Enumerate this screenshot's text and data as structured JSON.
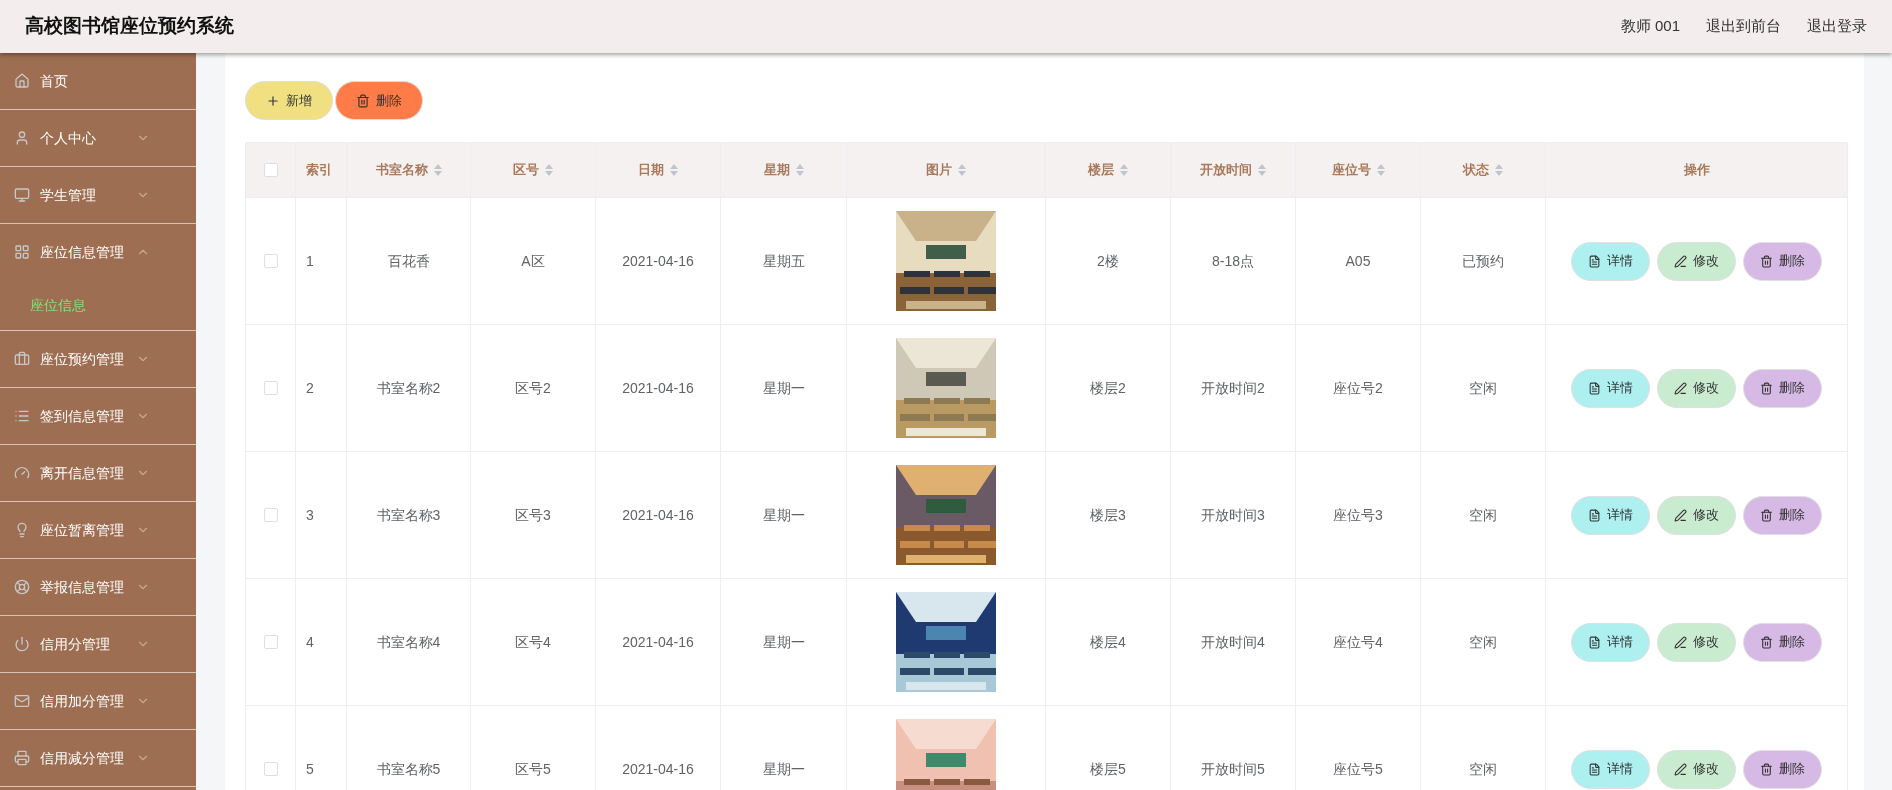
{
  "header": {
    "title": "高校图书馆座位预约系统",
    "user": "教师 001",
    "links": [
      "退出到前台",
      "退出登录"
    ]
  },
  "sidebar": {
    "items": [
      {
        "label": "首页",
        "expandable": false
      },
      {
        "label": "个人中心",
        "expandable": true,
        "expanded": false
      },
      {
        "label": "学生管理",
        "expandable": true,
        "expanded": false
      },
      {
        "label": "座位信息管理",
        "expandable": true,
        "expanded": true,
        "children": [
          {
            "label": "座位信息",
            "selected": true
          }
        ]
      },
      {
        "label": "座位预约管理",
        "expandable": true,
        "expanded": false
      },
      {
        "label": "签到信息管理",
        "expandable": true,
        "expanded": false
      },
      {
        "label": "离开信息管理",
        "expandable": true,
        "expanded": false
      },
      {
        "label": "座位暂离管理",
        "expandable": true,
        "expanded": false
      },
      {
        "label": "举报信息管理",
        "expandable": true,
        "expanded": false
      },
      {
        "label": "信用分管理",
        "expandable": true,
        "expanded": false
      },
      {
        "label": "信用加分管理",
        "expandable": true,
        "expanded": false
      },
      {
        "label": "信用减分管理",
        "expandable": true,
        "expanded": false
      }
    ]
  },
  "toolbar": [
    {
      "kind": "add",
      "label": "新增"
    },
    {
      "kind": "delete",
      "label": "删除"
    }
  ],
  "table": {
    "select_all": {
      "checked": false
    },
    "columns": [
      {
        "label": "索引",
        "sortable": false
      },
      {
        "label": "书室名称",
        "sortable": true
      },
      {
        "label": "区号",
        "sortable": true
      },
      {
        "label": "日期",
        "sortable": true
      },
      {
        "label": "星期",
        "sortable": true
      },
      {
        "label": "图片",
        "sortable": true
      },
      {
        "label": "楼层",
        "sortable": true
      },
      {
        "label": "开放时间",
        "sortable": true
      },
      {
        "label": "座位号",
        "sortable": true
      },
      {
        "label": "状态",
        "sortable": true
      },
      {
        "label": "操作",
        "sortable": false
      }
    ],
    "rows": [
      {
        "checked": false,
        "cells": [
          "1",
          "百花香",
          "A区",
          "2021-04-16",
          "星期五"
        ],
        "image": {
          "kind": "picture"
        },
        "cells2": [
          "2楼",
          "8-18点",
          "A05",
          "已预约"
        ],
        "actions": [
          {
            "kind": "detail",
            "label": "详情"
          },
          {
            "kind": "edit",
            "label": "修改"
          },
          {
            "kind": "delete",
            "label": "删除"
          }
        ]
      },
      {
        "checked": false,
        "cells": [
          "2",
          "书室名称2",
          "区号2",
          "2021-04-16",
          "星期一"
        ],
        "image": {
          "kind": "picture"
        },
        "cells2": [
          "楼层2",
          "开放时间2",
          "座位号2",
          "空闲"
        ],
        "actions": [
          {
            "kind": "detail",
            "label": "详情"
          },
          {
            "kind": "edit",
            "label": "修改"
          },
          {
            "kind": "delete",
            "label": "删除"
          }
        ]
      },
      {
        "checked": false,
        "cells": [
          "3",
          "书室名称3",
          "区号3",
          "2021-04-16",
          "星期一"
        ],
        "image": {
          "kind": "picture"
        },
        "cells2": [
          "楼层3",
          "开放时间3",
          "座位号3",
          "空闲"
        ],
        "actions": [
          {
            "kind": "detail",
            "label": "详情"
          },
          {
            "kind": "edit",
            "label": "修改"
          },
          {
            "kind": "delete",
            "label": "删除"
          }
        ]
      },
      {
        "checked": false,
        "cells": [
          "4",
          "书室名称4",
          "区号4",
          "2021-04-16",
          "星期一"
        ],
        "image": {
          "kind": "picture"
        },
        "cells2": [
          "楼层4",
          "开放时间4",
          "座位号4",
          "空闲"
        ],
        "actions": [
          {
            "kind": "detail",
            "label": "详情"
          },
          {
            "kind": "edit",
            "label": "修改"
          },
          {
            "kind": "delete",
            "label": "删除"
          }
        ]
      },
      {
        "checked": false,
        "cells": [
          "5",
          "书室名称5",
          "区号5",
          "2021-04-16",
          "星期一"
        ],
        "image": {
          "kind": "picture"
        },
        "cells2": [
          "楼层5",
          "开放时间5",
          "座位号5",
          "空闲"
        ],
        "actions": [
          {
            "kind": "detail",
            "label": "详情"
          },
          {
            "kind": "edit",
            "label": "修改"
          },
          {
            "kind": "delete",
            "label": "删除"
          }
        ]
      }
    ]
  }
}
